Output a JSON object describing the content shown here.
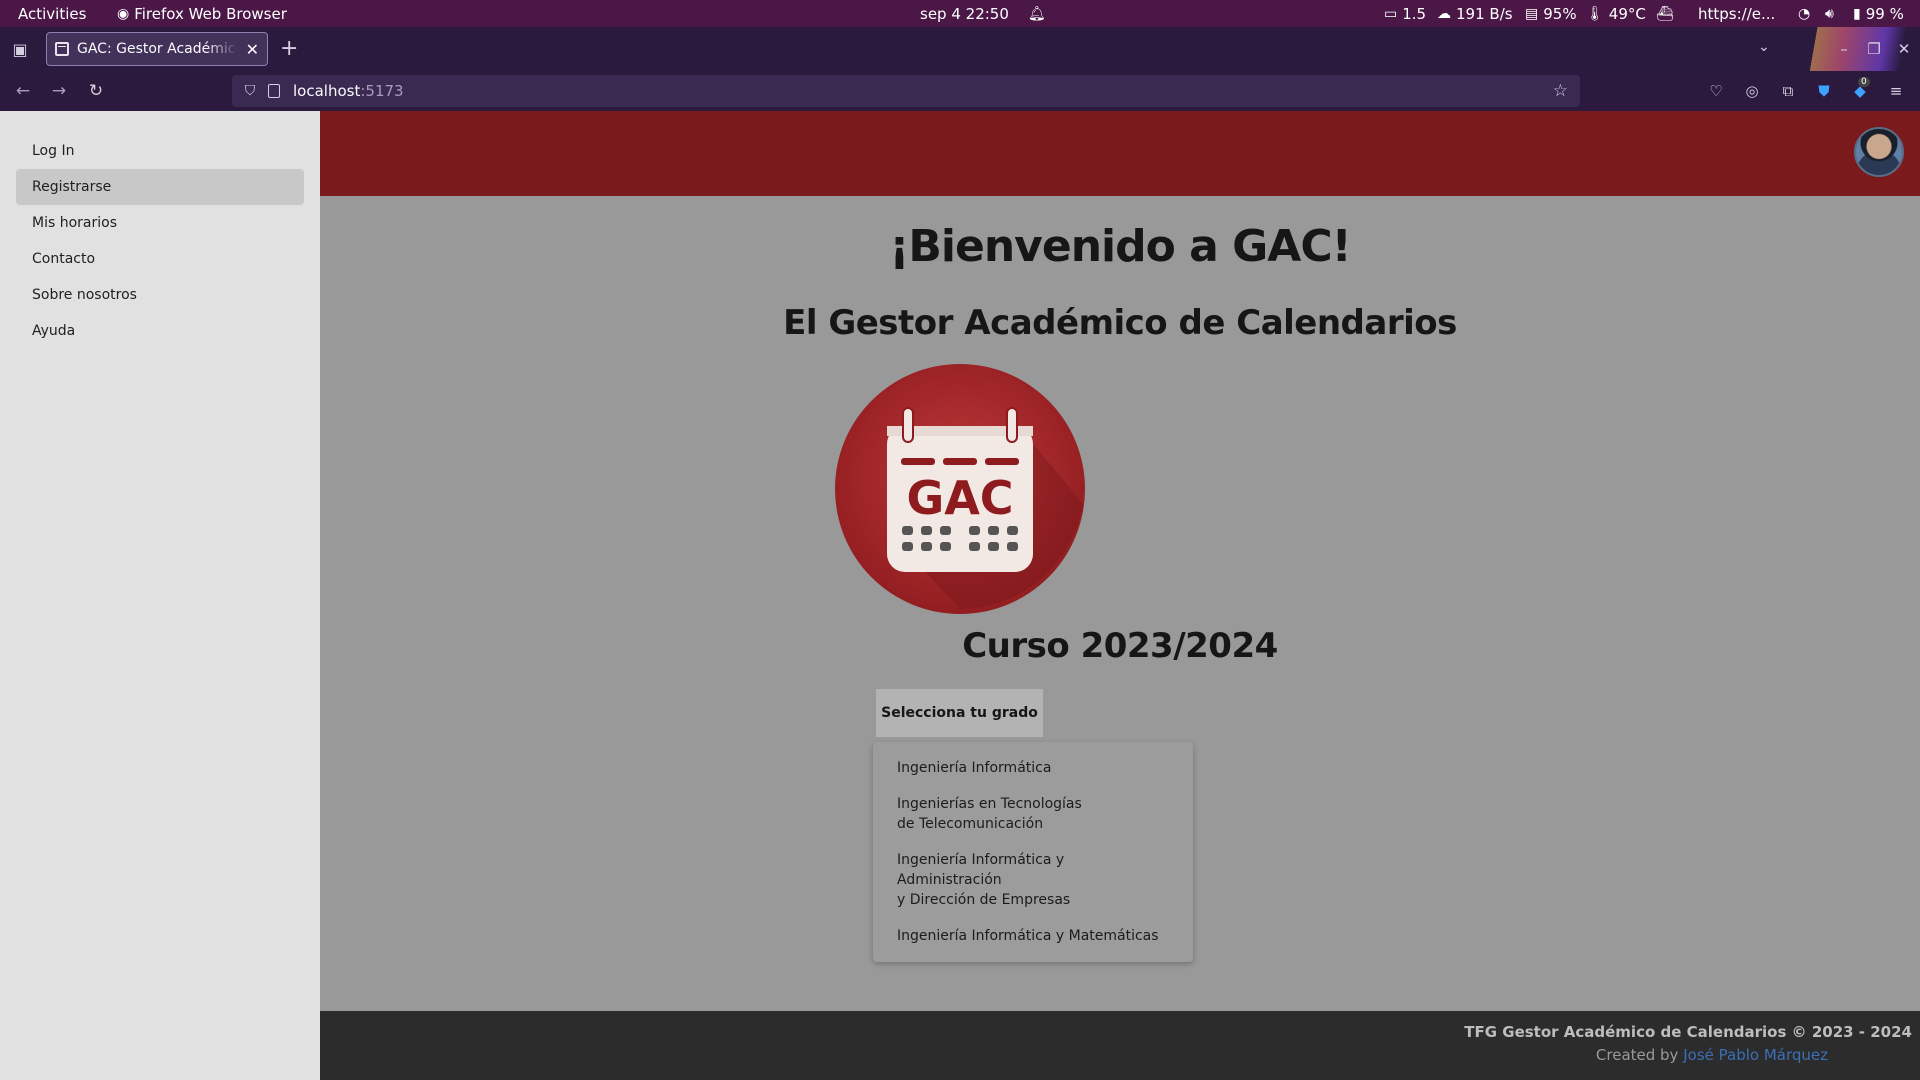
{
  "os_bar": {
    "activities": "Activities",
    "app_name": "Firefox Web Browser",
    "datetime": "sep 4  22:50",
    "monitor": "1.5",
    "network": "191 B/s",
    "memory": "95%",
    "temperature": "49°C",
    "url_indicator": "https://e...",
    "battery": "99 %"
  },
  "browser": {
    "tab_title": "GAC: Gestor Académico de Calendarios",
    "url_host": "localhost",
    "url_port": ":5173",
    "extension_badge": "0"
  },
  "sidebar": {
    "items": [
      {
        "label": "Log In"
      },
      {
        "label": "Registrarse"
      },
      {
        "label": "Mis horarios"
      },
      {
        "label": "Contacto"
      },
      {
        "label": "Sobre nosotros"
      },
      {
        "label": "Ayuda"
      }
    ]
  },
  "main": {
    "welcome": "¡Bienvenido a GAC!",
    "subtitle": "El Gestor Académico de Calendarios",
    "logo_text": "GAC",
    "course": "Curso 2023/2024",
    "grade_button": "Selecciona tu grado",
    "grades": [
      {
        "line1": "Ingeniería Informática",
        "line2": ""
      },
      {
        "line1": "Ingenierías en Tecnologías",
        "line2": "de Telecomunicación"
      },
      {
        "line1": "Ingeniería Informática y Administración",
        "line2": "y Dirección de Empresas"
      },
      {
        "line1": "Ingeniería Informática y Matemáticas",
        "line2": ""
      }
    ]
  },
  "footer": {
    "copyright": "TFG Gestor Académico de Calendarios © 2023 - 2024",
    "created_by": "Created by",
    "author": "José Pablo Márquez"
  },
  "colors": {
    "header": "#7b1a1d",
    "page_bg": "#999999",
    "sidebar_bg": "#e1e1e1",
    "footer_bg": "#2c2c2c",
    "link": "#3b6fb6"
  }
}
